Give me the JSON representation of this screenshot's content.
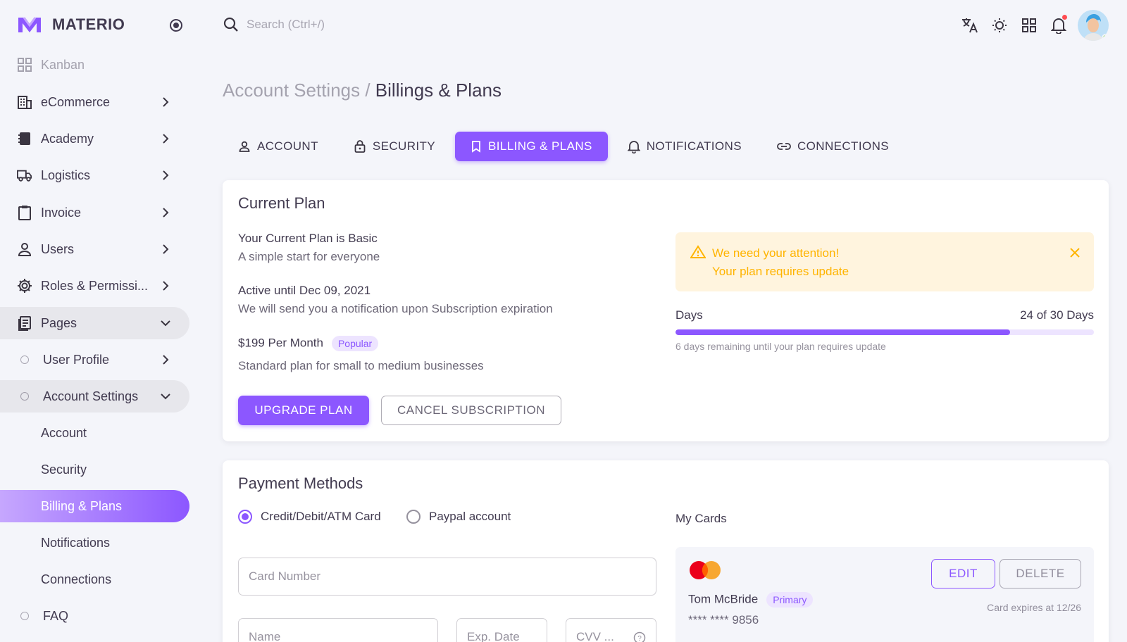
{
  "brand": {
    "name": "MATERIO",
    "logo_color": "#8c57ff"
  },
  "sidebar": {
    "items": [
      {
        "label": "Kanban",
        "icon": "kanban-icon"
      },
      {
        "label": "eCommerce",
        "icon": "building-icon"
      },
      {
        "label": "Academy",
        "icon": "book-icon"
      },
      {
        "label": "Logistics",
        "icon": "truck-icon"
      },
      {
        "label": "Invoice",
        "icon": "clipboard-icon"
      },
      {
        "label": "Users",
        "icon": "user-icon"
      },
      {
        "label": "Roles & Permissi...",
        "icon": "gear-icon"
      },
      {
        "label": "Pages",
        "icon": "pages-icon"
      }
    ],
    "pages_children": [
      {
        "label": "User Profile"
      },
      {
        "label": "Account Settings"
      }
    ],
    "account_children": [
      "Account",
      "Security",
      "Billing & Plans",
      "Notifications",
      "Connections"
    ],
    "faq": "FAQ"
  },
  "search": {
    "placeholder": "Search (Ctrl+/)"
  },
  "breadcrumb": {
    "parent": "Account Settings /",
    "current": "Billings & Plans"
  },
  "tabs": [
    "Account",
    "Security",
    "Billing & Plans",
    "Notifications",
    "Connections"
  ],
  "current_plan": {
    "title": "Current Plan",
    "plan_heading": "Your Current Plan is Basic",
    "plan_desc": "A simple start for everyone",
    "active_heading": "Active until Dec 09, 2021",
    "active_desc": "We will send you a notification upon Subscription expiration",
    "price_heading": "$199 Per Month",
    "price_badge": "Popular",
    "price_desc": "Standard plan for small to medium businesses",
    "upgrade_label": "Upgrade Plan",
    "cancel_label": "Cancel Subscription",
    "alert_title": "We need your attention!",
    "alert_text": "Your plan requires update",
    "days_label": "Days",
    "days_value": "24 of 30 Days",
    "days_progress": 0.8,
    "days_note": "6 days remaining until your plan requires update"
  },
  "payment": {
    "title": "Payment Methods",
    "option_card": "Credit/Debit/ATM Card",
    "option_paypal": "Paypal account",
    "card_number_placeholder": "Card Number",
    "name_placeholder": "Name",
    "exp_placeholder": "Exp. Date",
    "cvv_placeholder": "CVV ...",
    "my_cards_label": "My Cards",
    "card": {
      "holder": "Tom McBride",
      "badge": "Primary",
      "number": "**** **** 9856",
      "expiry": "Card expires at 12/26",
      "edit_label": "Edit",
      "delete_label": "Delete"
    }
  },
  "colors": {
    "primary": "#8c57ff",
    "warning": "#ffb400",
    "background": "#f4f5fa"
  }
}
